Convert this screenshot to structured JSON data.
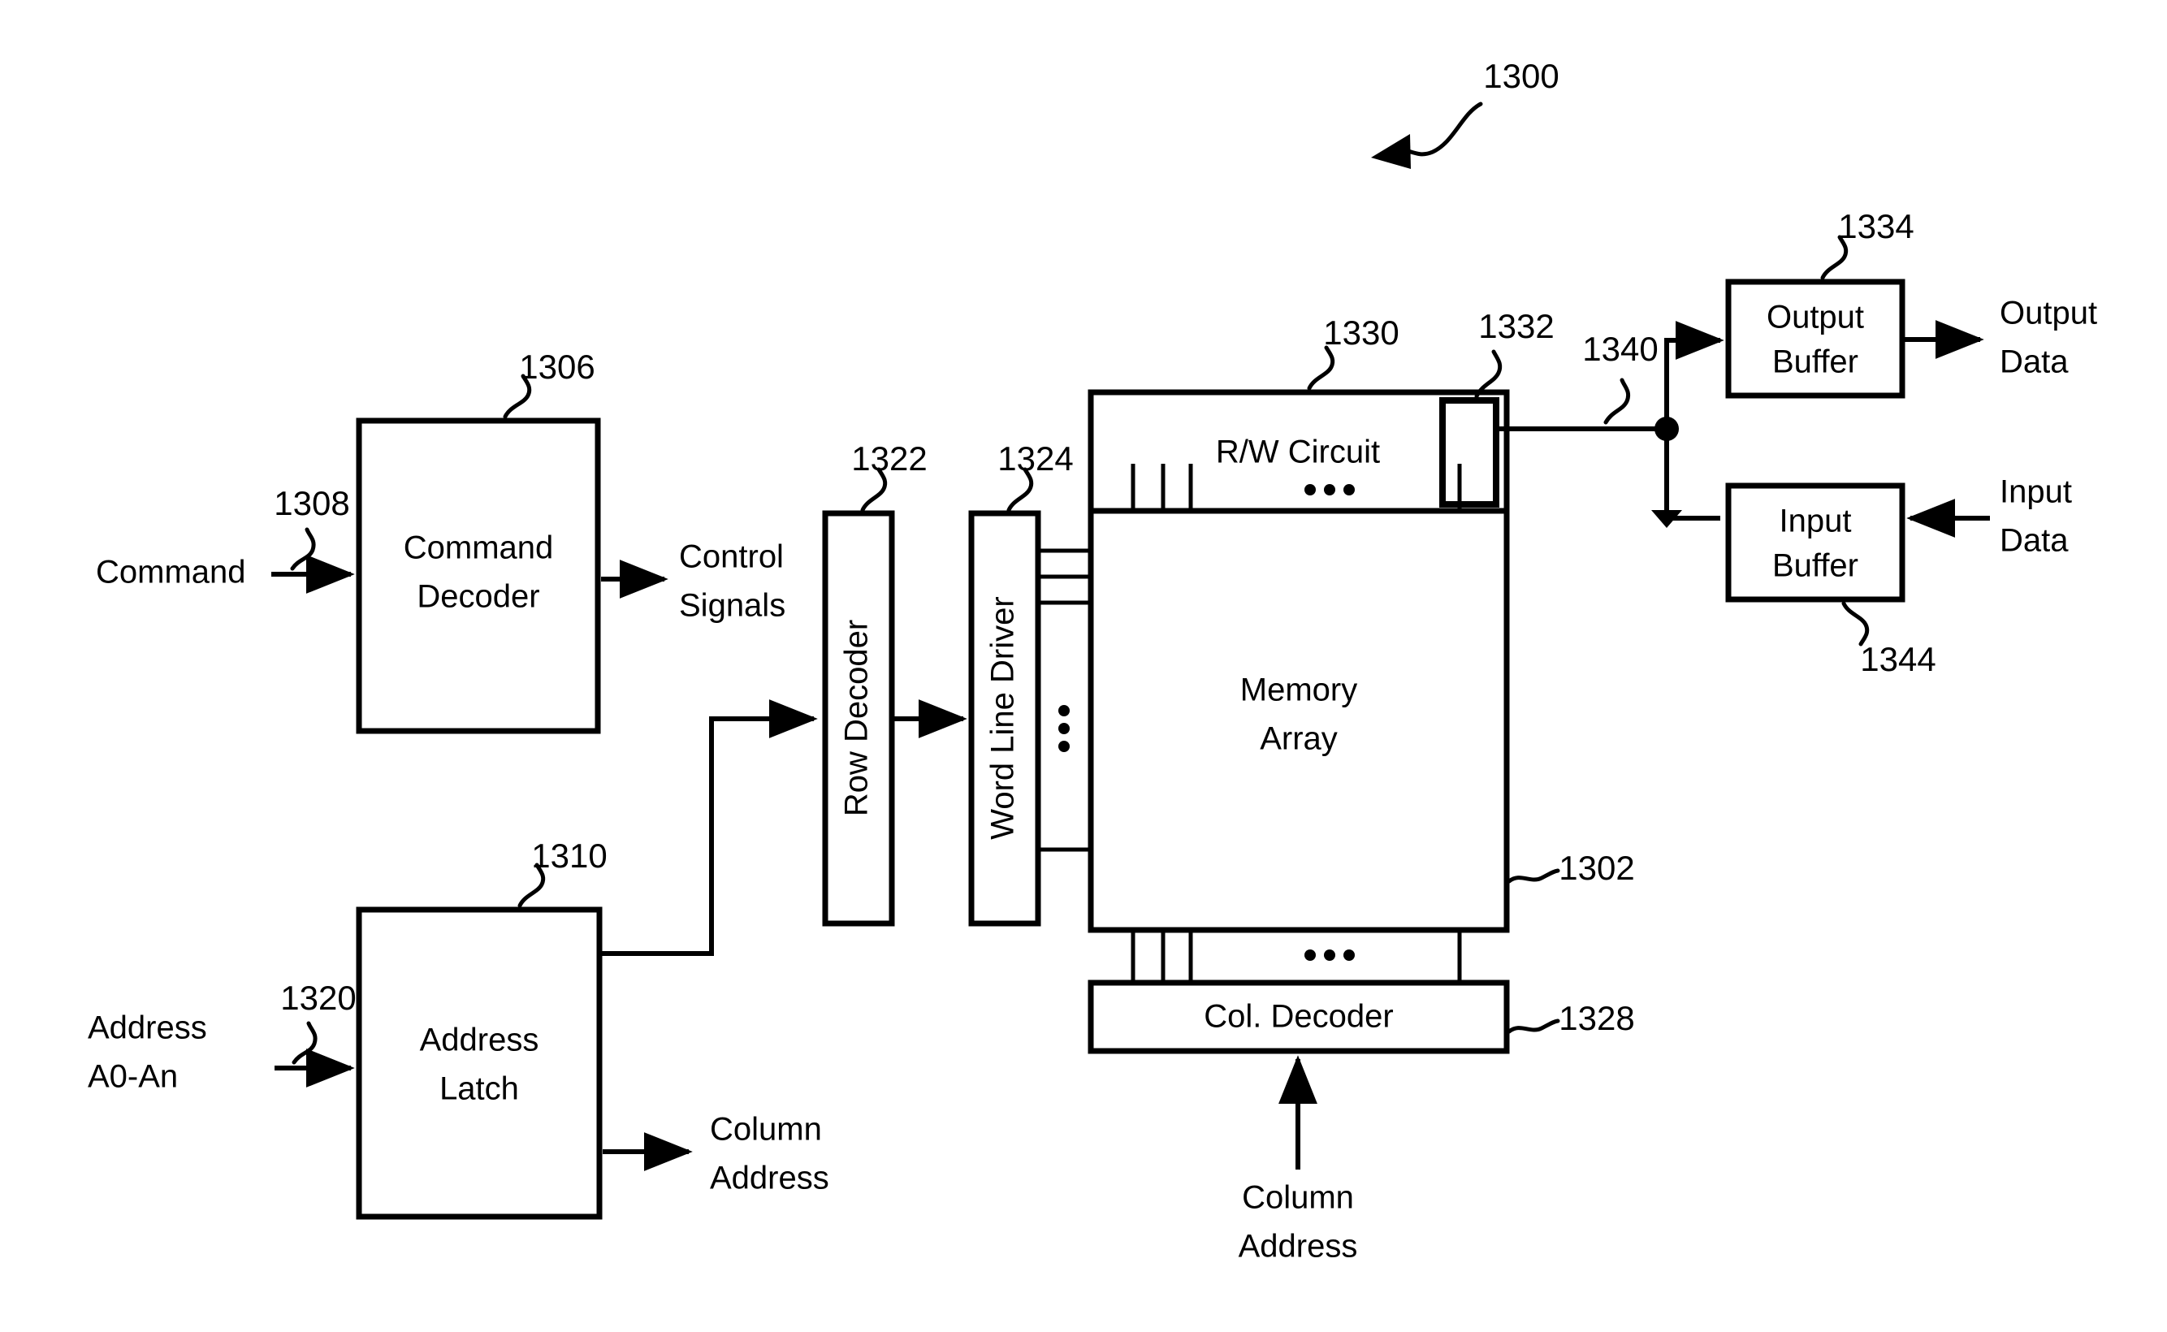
{
  "figure": {
    "number": "1300",
    "type": "memory-device-block-diagram"
  },
  "blocks": {
    "command_decoder": {
      "line1": "Command",
      "line2": "Decoder",
      "ref": "1306"
    },
    "address_latch": {
      "line1": "Address",
      "line2": "Latch",
      "ref": "1310"
    },
    "row_decoder": {
      "label": "Row Decoder",
      "ref": "1322"
    },
    "word_line_driver": {
      "label": "Word Line Driver",
      "ref": "1324"
    },
    "rw_circuit": {
      "label": "R/W Circuit",
      "ref": "1330",
      "inner_ref": "1332"
    },
    "memory_array": {
      "line1": "Memory",
      "line2": "Array",
      "ref": "1302"
    },
    "col_decoder": {
      "label": "Col. Decoder",
      "ref": "1328"
    },
    "output_buffer": {
      "line1": "Output",
      "line2": "Buffer",
      "ref": "1334"
    },
    "input_buffer": {
      "line1": "Input",
      "line2": "Buffer",
      "ref": "1344"
    }
  },
  "signals": {
    "command_in": {
      "label": "Command",
      "ref": "1308"
    },
    "control_signals_out": {
      "line1": "Control",
      "line2": "Signals"
    },
    "address_in": {
      "line1": "Address",
      "line2": "A0-An",
      "ref": "1320"
    },
    "column_address_out": {
      "line1": "Column",
      "line2": "Address"
    },
    "column_address_in": {
      "line1": "Column",
      "line2": "Address"
    },
    "data_bus": {
      "ref": "1340"
    },
    "output_data": {
      "line1": "Output",
      "line2": "Data"
    },
    "input_data": {
      "line1": "Input",
      "line2": "Data"
    }
  },
  "ellipses": {
    "word_lines": "vertical-three-dots",
    "bitlines_top": "horizontal-three-dots",
    "bitlines_bottom": "horizontal-three-dots"
  },
  "colors": {
    "ink": "#000000",
    "paper": "#ffffff"
  }
}
